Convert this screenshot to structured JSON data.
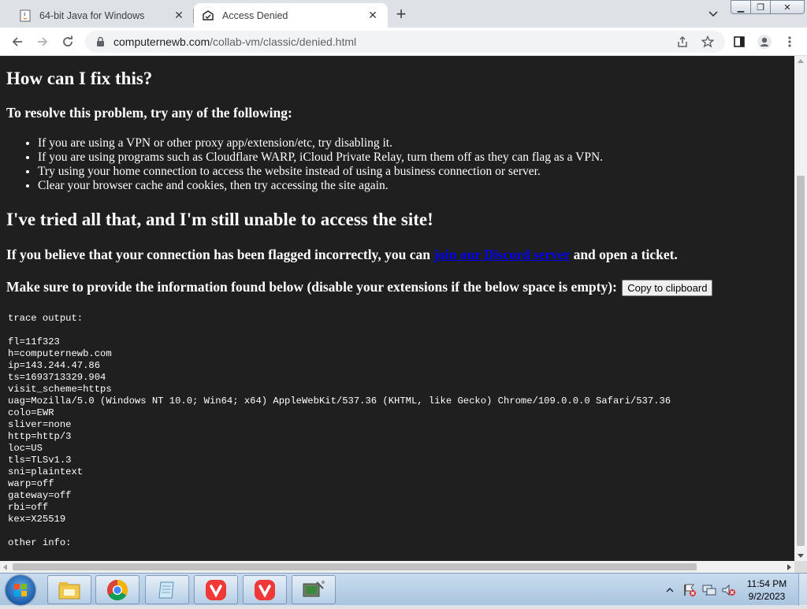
{
  "browser": {
    "tabs": [
      {
        "title": "64-bit Java for Windows",
        "active": false,
        "favicon": "java-page-icon"
      },
      {
        "title": "Access Denied",
        "active": true,
        "favicon": "cloudflare-icon"
      }
    ],
    "address": {
      "domain": "computernewb.com",
      "path": "/collab-vm/classic/denied.html"
    }
  },
  "page": {
    "heading_fix": "How can I fix this?",
    "subheading_resolve": "To resolve this problem, try any of the following:",
    "tips": [
      "If you are using a VPN or other proxy app/extension/etc, try disabling it.",
      "If you are using programs such as Cloudflare WARP, iCloud Private Relay, turn them off as they can flag as a VPN.",
      "Try using your home connection to access the website instead of using a business connection or server.",
      "Clear your browser cache and cookies, then try accessing the site again."
    ],
    "heading_tried": "I've tried all that, and I'm still unable to access the site!",
    "flagged_before": "If you believe that your connection has been flagged incorrectly, you can ",
    "flagged_link": "join our Discord server",
    "flagged_after": " and open a ticket.",
    "provide_info": "Make sure to provide the information found below (disable your extensions if the below space is empty):",
    "copy_button": "Copy to clipboard",
    "trace_text": "trace output:\n\nfl=11f323\nh=computernewb.com\nip=143.244.47.86\nts=1693713329.904\nvisit_scheme=https\nuag=Mozilla/5.0 (Windows NT 10.0; Win64; x64) AppleWebKit/537.36 (KHTML, like Gecko) Chrome/109.0.0.0 Safari/537.36\ncolo=EWR\nsliver=none\nhttp=http/3\nloc=US\ntls=TLSv1.3\nsni=plaintext\nwarp=off\ngateway=off\nrbi=off\nkex=X25519\n\nother info:"
  },
  "taskbar": {
    "clock_time": "11:54 PM",
    "clock_date": "9/2/2023",
    "pinned": [
      "file-explorer-icon",
      "chrome-icon",
      "notepad-icon",
      "vivaldi-icon",
      "vivaldi-icon",
      "network-app-icon"
    ]
  }
}
